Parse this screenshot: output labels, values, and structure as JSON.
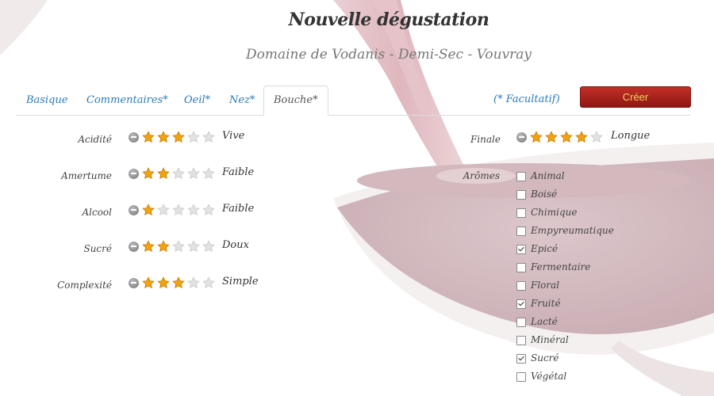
{
  "header": {
    "title": "Nouvelle dégustation",
    "subtitle": "Domaine de Vodanis - Demi-Sec - Vouvray"
  },
  "tabs": [
    {
      "label": "Basique",
      "active": false
    },
    {
      "label": "Commentaires*",
      "active": false
    },
    {
      "label": "Oeil*",
      "active": false
    },
    {
      "label": "Nez*",
      "active": false
    },
    {
      "label": "Bouche*",
      "active": true
    }
  ],
  "facultatif_note": "(* Facultatif)",
  "create_button": {
    "label": "Créer",
    "bg_color": "#a8231d",
    "text_color": "#f0d060"
  },
  "ratings_left": [
    {
      "label": "Acidité",
      "stars": 3,
      "max": 5,
      "value": "Vive"
    },
    {
      "label": "Amertume",
      "stars": 2,
      "max": 5,
      "value": "Faible"
    },
    {
      "label": "Alcool",
      "stars": 1,
      "max": 5,
      "value": "Faible"
    },
    {
      "label": "Sucré",
      "stars": 2,
      "max": 5,
      "value": "Doux"
    },
    {
      "label": "Complexité",
      "stars": 3,
      "max": 5,
      "value": "Simple"
    }
  ],
  "finale": {
    "label": "Finale",
    "stars": 4,
    "max": 5,
    "value": "Longue"
  },
  "aromes": {
    "label": "Arômes",
    "items": [
      {
        "label": "Animal",
        "checked": false
      },
      {
        "label": "Boisé",
        "checked": false
      },
      {
        "label": "Chimique",
        "checked": false
      },
      {
        "label": "Empyreumatique",
        "checked": false
      },
      {
        "label": "Epicé",
        "checked": true
      },
      {
        "label": "Fermentaire",
        "checked": false
      },
      {
        "label": "Floral",
        "checked": false
      },
      {
        "label": "Fruité",
        "checked": true
      },
      {
        "label": "Lacté",
        "checked": false
      },
      {
        "label": "Minéral",
        "checked": false
      },
      {
        "label": "Sucré",
        "checked": true
      },
      {
        "label": "Végétal",
        "checked": false
      }
    ]
  },
  "icons": {
    "star": "star-icon",
    "reset": "remove-circle-icon"
  },
  "colors": {
    "link": "#2a7ab8",
    "star_filled": "#f2a30f",
    "star_empty": "#e2e2e2",
    "wine": "#7a1d2a"
  }
}
